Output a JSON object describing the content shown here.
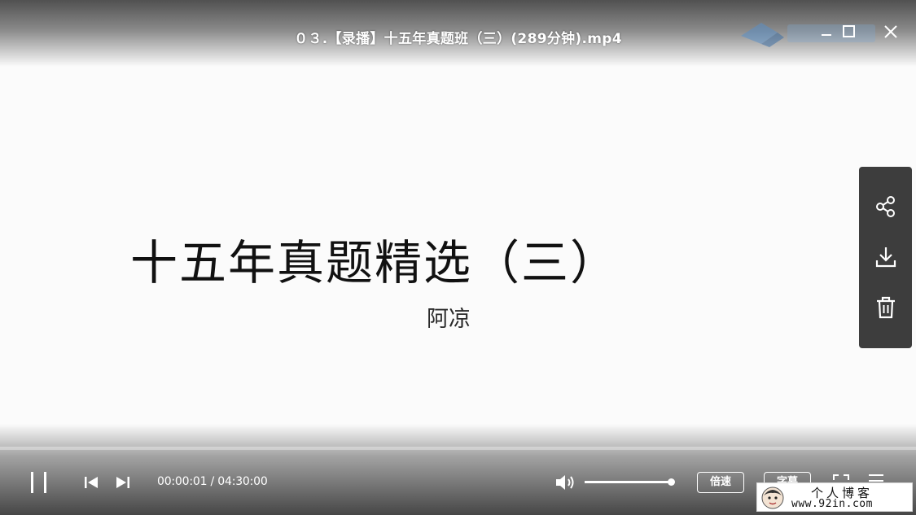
{
  "window": {
    "title": "０３.【录播】十五年真题班（三）(289分钟).mp4",
    "controls": [
      "minimize-icon",
      "maximize-icon",
      "close-icon"
    ]
  },
  "slide": {
    "title": "十五年真题精选（三）",
    "author": "阿凉"
  },
  "side_panel": {
    "items": [
      {
        "name": "share",
        "icon": "share-icon"
      },
      {
        "name": "download",
        "icon": "download-icon"
      },
      {
        "name": "delete",
        "icon": "trash-icon"
      }
    ]
  },
  "controls": {
    "play_state": "playing",
    "time": "00:00:01 / 04:30:00",
    "current_time": "00:00:01",
    "total_time": "04:30:00",
    "progress_fraction": 6e-05,
    "volume_fraction": 1.0,
    "speed_label": "倍速",
    "caption_label": "字幕",
    "icons": [
      "pause-icon",
      "previous-icon",
      "next-icon",
      "volume-icon",
      "fullscreen-icon",
      "playlist-icon"
    ]
  },
  "watermark": {
    "blog_name": "个人博客",
    "blog_url": "www.92in.com"
  },
  "colors": {
    "panel_bg": "#3d3d3d",
    "text_light": "#ffffff",
    "slide_bg": "#fbfbfb"
  }
}
